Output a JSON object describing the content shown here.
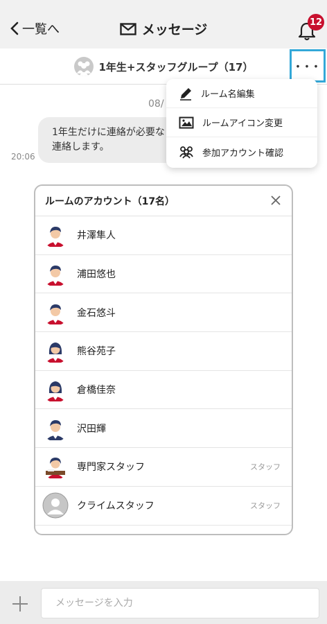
{
  "header": {
    "back_label": "一覧へ",
    "title": "メッセージ",
    "notification_count": "12"
  },
  "group": {
    "name": "1年生+スタッフグループ（17）",
    "more_label": "･･･"
  },
  "chat": {
    "date": "08/",
    "message_line1": "1年生だけに連絡が必要な",
    "message_line2": "連絡します。",
    "time": "20:06"
  },
  "menu": {
    "items": [
      {
        "label": "ルーム名編集",
        "icon": "pencil-icon"
      },
      {
        "label": "ルームアイコン変更",
        "icon": "image-icon"
      },
      {
        "label": "参加アカウント確認",
        "icon": "people-icon"
      }
    ]
  },
  "modal": {
    "title": "ルームのアカウント（17名）",
    "accounts": [
      {
        "name": "井澤隼人",
        "role": "",
        "avatar": "male-student-icon"
      },
      {
        "name": "浦田悠也",
        "role": "",
        "avatar": "male-student-icon"
      },
      {
        "name": "金石悠斗",
        "role": "",
        "avatar": "male-student-icon"
      },
      {
        "name": "熊谷苑子",
        "role": "",
        "avatar": "female-student-icon"
      },
      {
        "name": "倉橋佳奈",
        "role": "",
        "avatar": "female-student-icon"
      },
      {
        "name": "沢田輝",
        "role": "",
        "avatar": "male-staff-icon"
      },
      {
        "name": "専門家スタッフ",
        "role": "スタッフ",
        "avatar": "expert-staff-icon"
      },
      {
        "name": "クライムスタッフ",
        "role": "スタッフ",
        "avatar": "default-user-icon"
      }
    ]
  },
  "input": {
    "placeholder": "メッセージを入力"
  },
  "colors": {
    "accent_red": "#c8102e",
    "highlight_blue": "#33a8d8",
    "staff_navy": "#2b3a67"
  }
}
